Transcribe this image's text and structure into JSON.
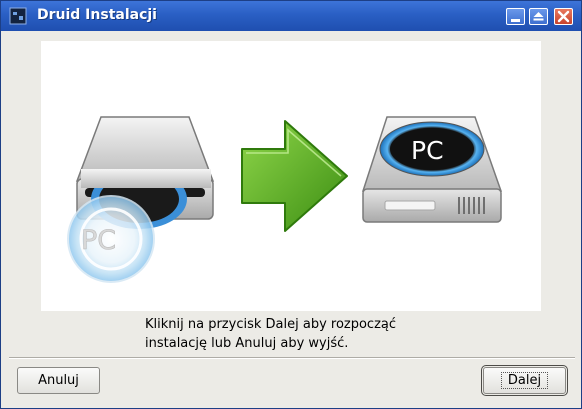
{
  "window": {
    "title": "Druid Instalacji",
    "controls": [
      "minimize",
      "maximize",
      "close"
    ]
  },
  "illustration": {
    "cd_drive_label": "PC",
    "hard_drive_label": "PC",
    "icons": [
      "cd-drive-icon",
      "arrow-right-icon",
      "hard-drive-icon"
    ],
    "colors": {
      "arrow": "#4fa61c",
      "disk_ring": "#3a9be8"
    }
  },
  "message": {
    "line1": "Kliknij na przycisk Dalej aby rozpocząć",
    "line2": "instalację lub Anuluj aby wyjść."
  },
  "buttons": {
    "cancel": "Anuluj",
    "next": "Dalej"
  }
}
